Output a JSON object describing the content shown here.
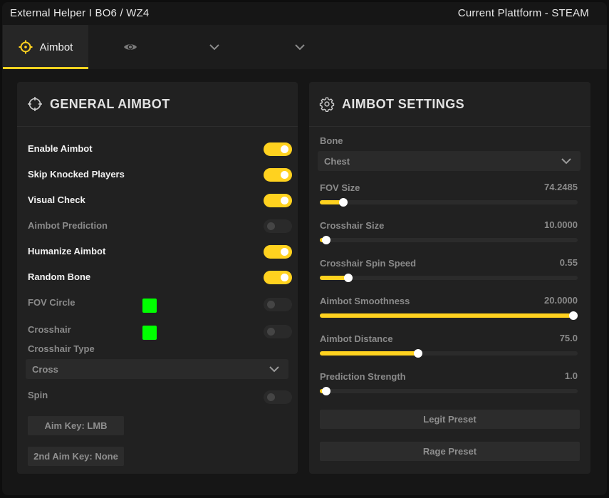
{
  "window": {
    "title": "External Helper I BO6 / WZ4",
    "platform": "Current Plattform - STEAM"
  },
  "tabs": [
    {
      "label": "Aimbot",
      "icon": "crosshair-icon",
      "active": true
    },
    {
      "label": "",
      "icon": "eye-icon",
      "active": false
    },
    {
      "label": "",
      "icon": "chevron-down-icon",
      "active": false
    },
    {
      "label": "",
      "icon": "chevron-down-icon",
      "active": false
    }
  ],
  "colors": {
    "accent": "#ffd21f",
    "swatch": "#00ff00",
    "panel": "#212121",
    "background": "#161616"
  },
  "general": {
    "title": "GENERAL AIMBOT",
    "icon": "crosshair-icon",
    "toggles": [
      {
        "label": "Enable Aimbot",
        "on": true
      },
      {
        "label": "Skip Knocked Players",
        "on": true
      },
      {
        "label": "Visual Check",
        "on": true
      },
      {
        "label": "Aimbot Prediction",
        "on": false
      },
      {
        "label": "Humanize Aimbot",
        "on": true
      },
      {
        "label": "Random Bone",
        "on": true
      },
      {
        "label": "FOV Circle",
        "on": false,
        "color": "#00ff00"
      },
      {
        "label": "Crosshair",
        "on": false,
        "color": "#00ff00"
      }
    ],
    "crosshair_type_label": "Crosshair Type",
    "crosshair_type_value": "Cross",
    "spin": {
      "label": "Spin",
      "on": false
    },
    "aim_key": "Aim Key: LMB",
    "aim_key2": "2nd Aim Key: None"
  },
  "settings": {
    "title": "AIMBOT SETTINGS",
    "icon": "gear-icon",
    "bone_label": "Bone",
    "bone_value": "Chest",
    "sliders": [
      {
        "label": "FOV Size",
        "value": "74.2485",
        "fraction": 0.09
      },
      {
        "label": "Crosshair Size",
        "value": "10.0000",
        "fraction": 0.025
      },
      {
        "label": "Crosshair Spin Speed",
        "value": "0.55",
        "fraction": 0.11
      },
      {
        "label": "Aimbot Smoothness",
        "value": "20.0000",
        "fraction": 1.0
      },
      {
        "label": "Aimbot Distance",
        "value": "75.0",
        "fraction": 0.38
      },
      {
        "label": "Prediction Strength",
        "value": "1.0",
        "fraction": 0.025
      }
    ],
    "legit_preset": "Legit Preset",
    "rage_preset": "Rage Preset"
  }
}
